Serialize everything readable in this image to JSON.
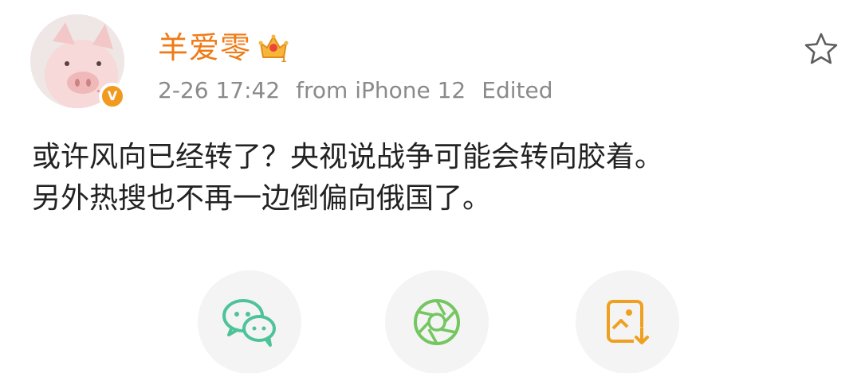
{
  "user": {
    "name": "羊爱零",
    "avatar_icon": "pig-avatar",
    "badge_icon": "verified-v-icon",
    "badge_text": "V",
    "vip_icon": "crown-icon",
    "vip_level": "1"
  },
  "meta": {
    "timestamp": "2-26 17:42",
    "source": "from iPhone 12",
    "edited": "Edited"
  },
  "favorite": {
    "icon": "star-icon"
  },
  "post": {
    "lines": [
      "或许风向已经转了？央视说战争可能会转向胶着。",
      "另外热搜也不再一边倒偏向俄国了。"
    ]
  },
  "share": {
    "buttons": [
      {
        "icon": "wechat-icon",
        "color": "#4ec39a"
      },
      {
        "icon": "moments-aperture-icon",
        "color": "#74c660"
      },
      {
        "icon": "save-image-icon",
        "color": "#f0a020"
      }
    ]
  },
  "colors": {
    "username": "#ef7a16",
    "meta": "#8a8a8a",
    "body": "#222222",
    "badge": "#f29a1f"
  }
}
